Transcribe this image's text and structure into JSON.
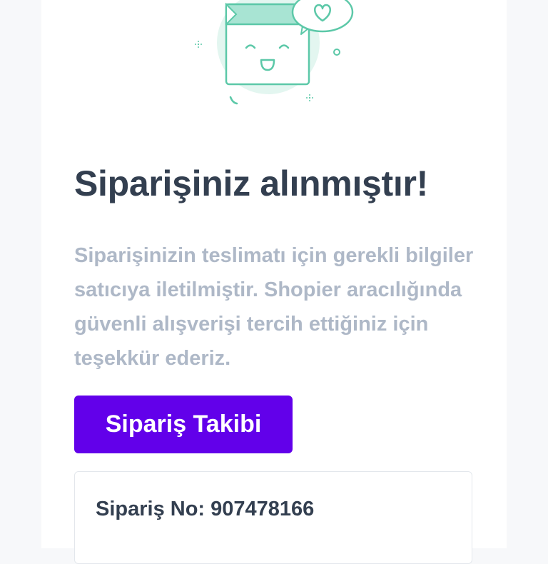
{
  "confirmation": {
    "title": "Siparişiniz alınmıştır!",
    "message": "Siparişinizin teslimatı için gerekli bilgiler satıcıya iletilmiştir. Shopier aracılığında güvenli alışverişi tercih ettiğiniz için teşekkür ederiz.",
    "track_button_label": "Sipariş Takibi"
  },
  "order": {
    "label": "Sipariş No:",
    "number": "907478166"
  },
  "colors": {
    "accent": "#6200ea",
    "title_text": "#333f50",
    "muted_text": "#aeb8c7",
    "illustration_green": "#5cc8a8"
  },
  "icons": {
    "illustration": "happy-shopping-bag-icon",
    "speech_bubble": "heart-icon"
  }
}
